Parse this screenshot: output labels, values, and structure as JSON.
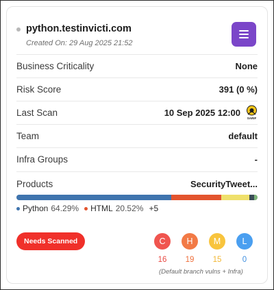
{
  "asset": {
    "host": "python.testinvicti.com",
    "created": "Created On: 29 Aug 2025 21:52"
  },
  "rows": {
    "business_criticality": {
      "label": "Business Criticality",
      "value": "None"
    },
    "risk_score": {
      "label": "Risk Score",
      "value": "391",
      "pct": "(0 %)"
    },
    "last_scan": {
      "label": "Last Scan",
      "value": "10 Sep 2025 12:00",
      "icon_caption": "SARIF"
    },
    "team": {
      "label": "Team",
      "value": "default"
    },
    "infra_groups": {
      "label": "Infra Groups",
      "value": "-"
    },
    "products": {
      "label": "Products",
      "value": "SecurityTweet..."
    }
  },
  "languages": {
    "segments": [
      {
        "name": "Python",
        "pct": 64.29,
        "color": "#3f74ae"
      },
      {
        "name": "HTML",
        "pct": 20.52,
        "color": "#e3542e"
      },
      {
        "name": "other-1",
        "pct": 11.7,
        "color": "#efe06b"
      },
      {
        "name": "other-2",
        "pct": 2.2,
        "color": "#3b4d56"
      },
      {
        "name": "other-3",
        "pct": 1.29,
        "color": "#7db37a"
      }
    ],
    "legend": [
      {
        "name": "Python",
        "pct": "64.29%",
        "color": "#3f74ae"
      },
      {
        "name": "HTML",
        "pct": "20.52%",
        "color": "#e3542e"
      }
    ],
    "more": "+5"
  },
  "status_button": "Needs Scanned",
  "severity": [
    {
      "letter": "C",
      "count": "16",
      "bg": "#f0554f",
      "fg": "#e84a44"
    },
    {
      "letter": "H",
      "count": "19",
      "bg": "#f27a46",
      "fg": "#ee6e3a"
    },
    {
      "letter": "M",
      "count": "15",
      "bg": "#f8c43d",
      "fg": "#f2b733"
    },
    {
      "letter": "L",
      "count": "0",
      "bg": "#4a9ff0",
      "fg": "#3f8fe0"
    }
  ],
  "severity_note": "(Default branch vulns + Infra)"
}
